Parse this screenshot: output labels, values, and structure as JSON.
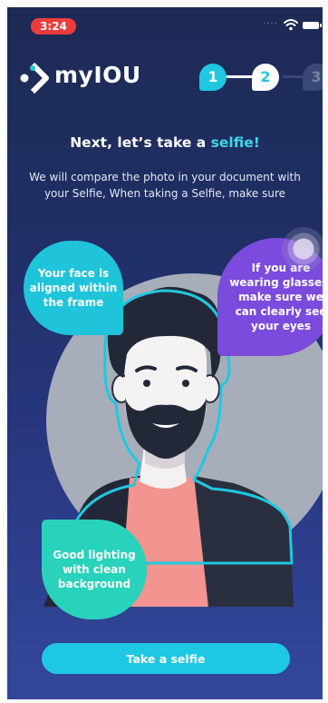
{
  "status_bar": {
    "time": "3:24",
    "dots": "····"
  },
  "header": {
    "logo_text": "myIOU",
    "steps": [
      {
        "label": "1",
        "state": "done"
      },
      {
        "label": "2",
        "state": "current"
      },
      {
        "label": "3",
        "state": "todo"
      }
    ]
  },
  "main": {
    "title_prefix": "Next, let’s take a ",
    "title_accent": "selfie!",
    "subtitle": "We will compare the photo in your document with your Selfie, When taking a Selfie, make sure",
    "tips": {
      "face": "Your face is aligned within the frame",
      "glasses": "If you are wearing glasses, make sure we can clearly see your eyes",
      "lighting": "Good lighting with clean background"
    }
  },
  "cta": {
    "label": "Take a selfie"
  },
  "colors": {
    "accent": "#1fc8e0",
    "background_top": "#1d2a55",
    "tip_face": "#1fc4da",
    "tip_glasses": "#7a4bdc",
    "tip_lighting": "#28d2bb",
    "status_time_bg": "#ef3b3b"
  },
  "icons": [
    "wifi-icon",
    "battery-icon",
    "logo-mark-icon",
    "touch-indicator"
  ]
}
